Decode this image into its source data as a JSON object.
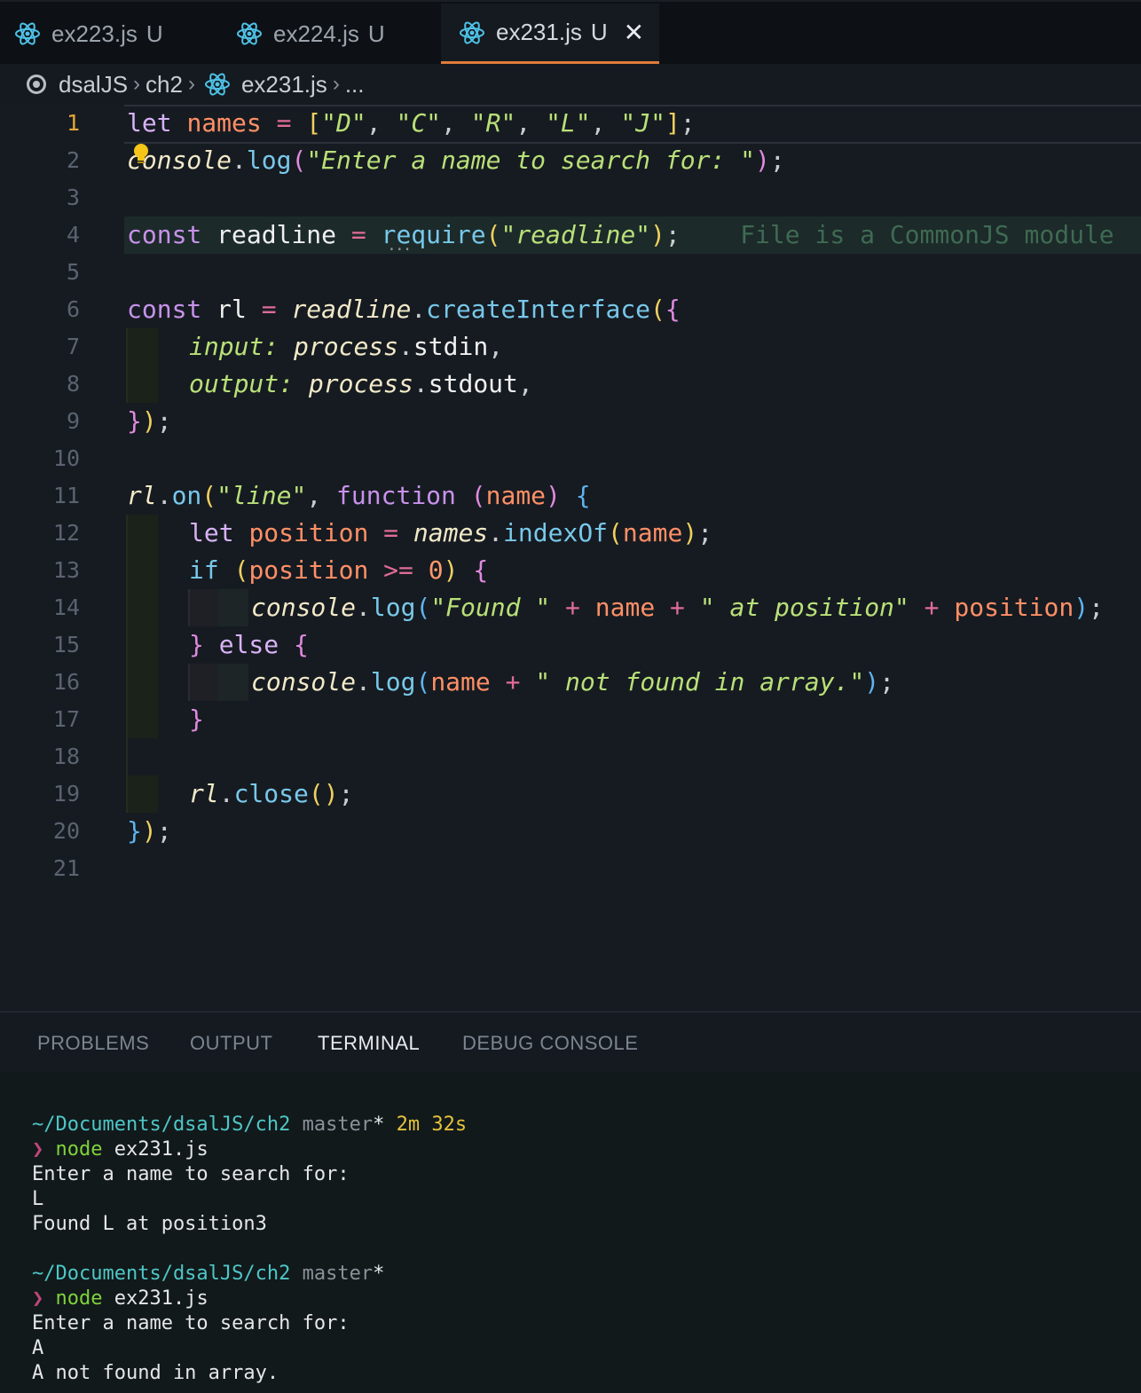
{
  "tabs": [
    {
      "name": "ex223.js",
      "status": "U"
    },
    {
      "name": "ex224.js",
      "status": "U"
    },
    {
      "name": "ex231.js",
      "status": "U",
      "close": "✕"
    }
  ],
  "breadcrumb": {
    "root": "dsalJS",
    "folder": "ch2",
    "file": "ex231.js",
    "more": "..."
  },
  "editor": {
    "line_numbers": [
      "1",
      "2",
      "3",
      "4",
      "5",
      "6",
      "7",
      "8",
      "9",
      "10",
      "11",
      "12",
      "13",
      "14",
      "15",
      "16",
      "17",
      "18",
      "19",
      "20",
      "21"
    ],
    "inline_hint": "File is a CommonJS module",
    "codelens_dots": "..."
  },
  "panel": {
    "tabs": [
      "PROBLEMS",
      "OUTPUT",
      "TERMINAL",
      "DEBUG CONSOLE"
    ],
    "active_tab": "TERMINAL"
  },
  "terminal": {
    "session1": {
      "path": "~/Documents/dsalJS/ch2",
      "branch": "master",
      "dirty": "*",
      "duration": "2m 32s",
      "prompt": "❯",
      "cmd": "node",
      "arg": "ex231.js",
      "out1": "Enter a name to search for:",
      "input": "L",
      "result": "Found L at position3"
    },
    "session2": {
      "path": "~/Documents/dsalJS/ch2",
      "branch": "master",
      "dirty": "*",
      "prompt": "❯",
      "cmd": "node",
      "arg": "ex231.js",
      "out1": "Enter a name to search for:",
      "input": "A",
      "result": "A not found in array."
    }
  },
  "colors": {
    "accent": "#e07b39",
    "react": "#4fc3e8",
    "keyword": "#c792ea",
    "string": "#b9e078",
    "variable": "#ff8f66"
  }
}
